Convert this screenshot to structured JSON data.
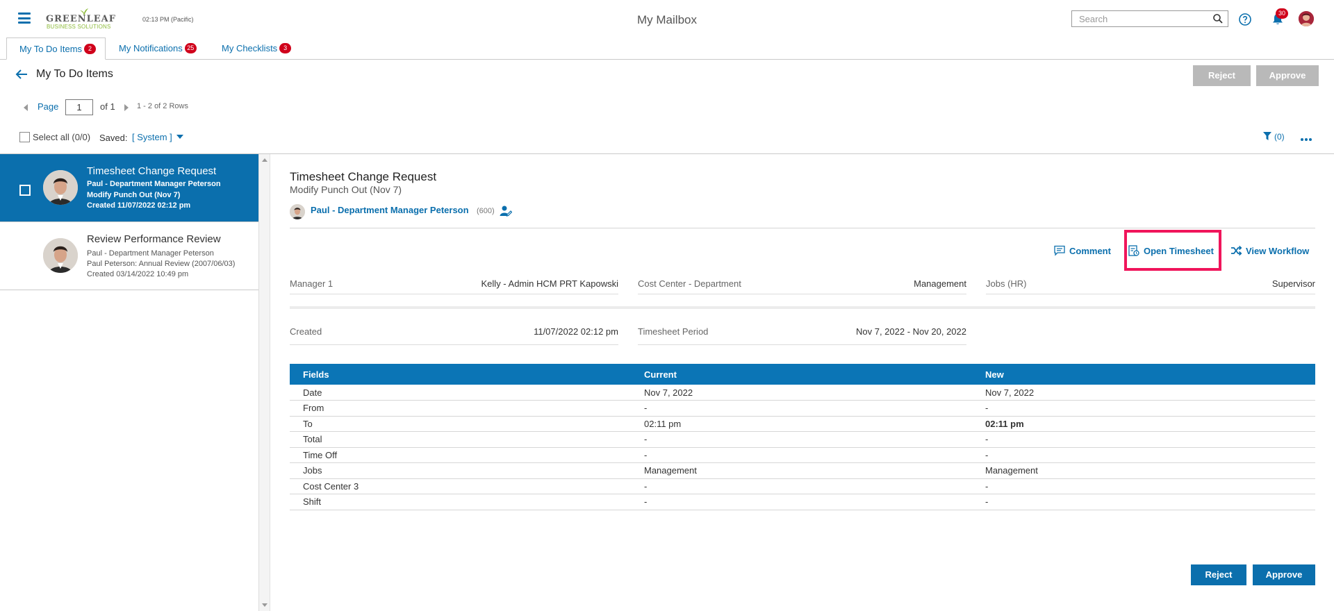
{
  "header": {
    "logo_line1": "GREENLEAF",
    "logo_line2": "BUSINESS SOLUTIONS",
    "time": "02:13 PM (Pacific)",
    "title": "My Mailbox",
    "search_placeholder": "Search",
    "notification_count": "30"
  },
  "tabs": [
    {
      "label": "My To Do Items",
      "badge": "2",
      "active": true
    },
    {
      "label": "My Notifications",
      "badge": "25",
      "active": false
    },
    {
      "label": "My Checklists",
      "badge": "3",
      "active": false
    }
  ],
  "section": {
    "title": "My To Do Items",
    "reject_label": "Reject",
    "approve_label": "Approve"
  },
  "pager": {
    "page_label": "Page",
    "page_value": "1",
    "of_label": "of 1",
    "rows_label": "1 - 2 of 2 Rows"
  },
  "toolbar": {
    "select_all": "Select all (0/0)",
    "saved_label": "Saved:",
    "saved_value": "[ System ]",
    "filter_label": "(0)"
  },
  "list": [
    {
      "title": "Timesheet Change Request",
      "line1": "Paul - Department Manager Peterson",
      "line2": "Modify Punch Out (Nov 7)",
      "line3": "Created 11/07/2022 02:12 pm",
      "selected": true
    },
    {
      "title": "Review Performance Review",
      "line1": "Paul - Department Manager Peterson",
      "line2": "Paul Peterson: Annual Review (2007/06/03)",
      "line3": "Created 03/14/2022 10:49 pm",
      "selected": false
    }
  ],
  "detail": {
    "title": "Timesheet Change Request",
    "subtitle": "Modify Punch Out (Nov 7)",
    "person": "Paul - Department Manager Peterson",
    "person_id": "(600)",
    "actions": {
      "comment": "Comment",
      "open_timesheet": "Open Timesheet",
      "view_workflow": "View Workflow"
    },
    "info": {
      "manager_label": "Manager 1",
      "manager_value": "Kelly - Admin HCM PRT Kapowski",
      "cost_center_label": "Cost Center - Department",
      "cost_center_value": "Management",
      "jobs_label": "Jobs (HR)",
      "jobs_value": "Supervisor",
      "created_label": "Created",
      "created_value": "11/07/2022 02:12 pm",
      "period_label": "Timesheet Period",
      "period_value": "Nov 7, 2022 - Nov 20, 2022"
    },
    "table": {
      "headers": [
        "Fields",
        "Current",
        "New"
      ],
      "rows": [
        [
          "Date",
          "Nov 7, 2022",
          "Nov 7, 2022"
        ],
        [
          "From",
          "-",
          "-"
        ],
        [
          "To",
          "02:11 pm",
          "02:11 pm"
        ],
        [
          "Total",
          "-",
          "-"
        ],
        [
          "Time Off",
          "-",
          "-"
        ],
        [
          "Jobs",
          "Management",
          "Management"
        ],
        [
          "Cost Center 3",
          "-",
          "-"
        ],
        [
          "Shift",
          "-",
          "-"
        ]
      ]
    },
    "reject_label": "Reject",
    "approve_label": "Approve"
  },
  "colors": {
    "accent": "#0b6fad",
    "badge": "#d0021b",
    "highlight": "#f0155b",
    "disabled_button": "#b9b9b9"
  }
}
